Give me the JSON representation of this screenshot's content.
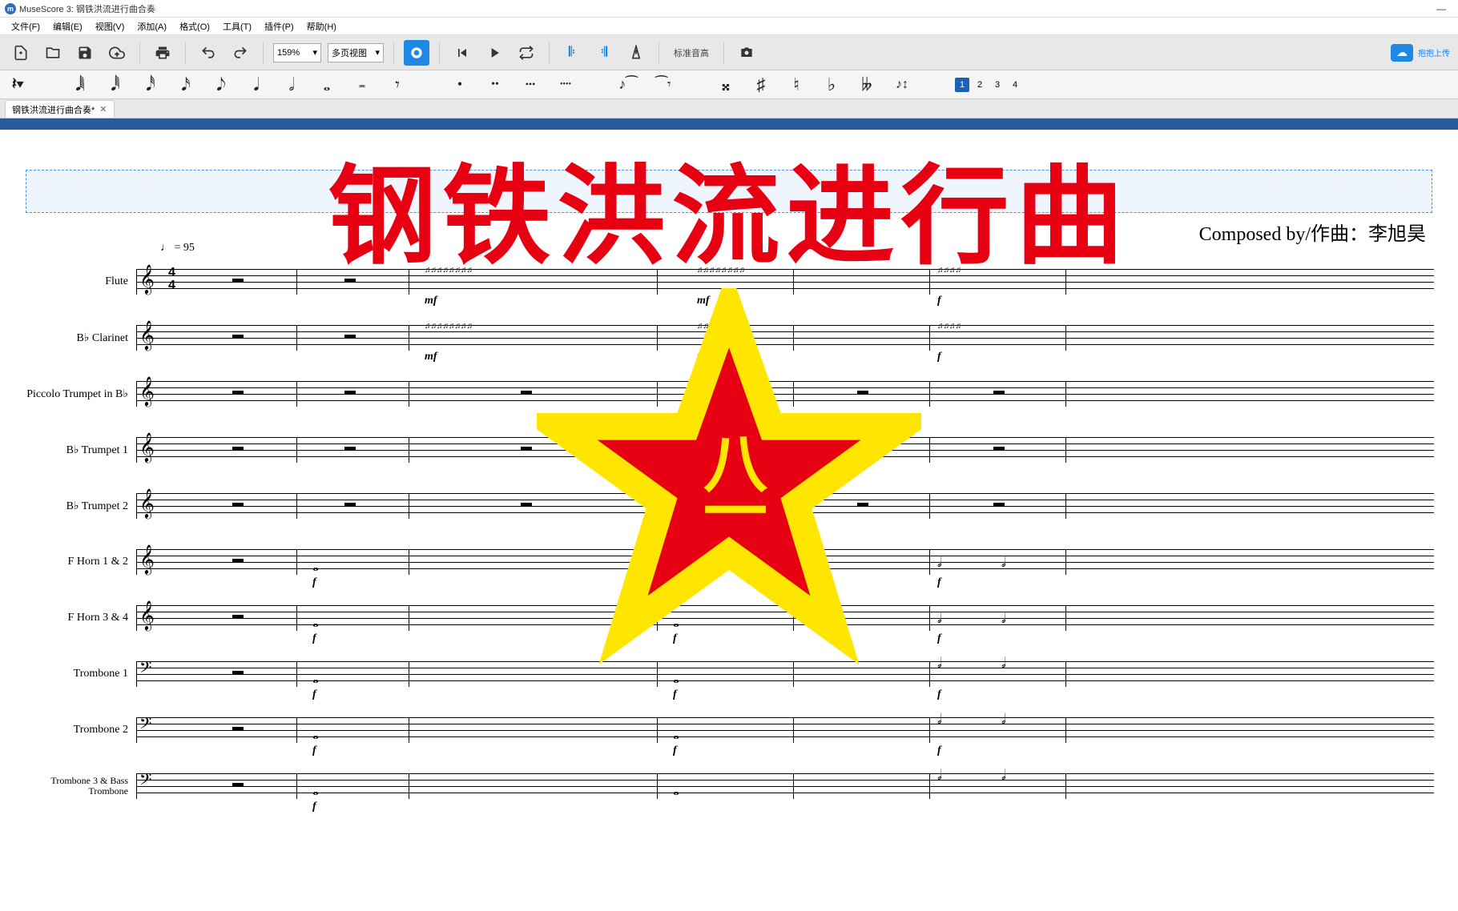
{
  "titlebar": {
    "app_name": "MuseScore 3: 钢铁洪流进行曲合奏"
  },
  "menubar": {
    "items": [
      "文件(F)",
      "编辑(E)",
      "视图(V)",
      "添加(A)",
      "格式(O)",
      "工具(T)",
      "插件(P)",
      "帮助(H)"
    ]
  },
  "toolbar": {
    "zoom": "159%",
    "view_mode": "多页视图",
    "concert_pitch": "标准音高",
    "upload_label": "抱抱上传"
  },
  "voices": [
    "1",
    "2",
    "3",
    "4"
  ],
  "tab": {
    "name": "钢铁洪流进行曲合奏*"
  },
  "score": {
    "composer_label": "Composed by/作曲：李旭昊",
    "tempo": "♩ = 95",
    "time_signature_top": "4",
    "time_signature_bottom": "4",
    "instruments": [
      "Flute",
      "B♭ Clarinet",
      "Piccolo Trumpet in B♭",
      "B♭ Trumpet 1",
      "B♭ Trumpet 2",
      "F Horn 1 & 2",
      "F Horn 3 & 4",
      "Trombone 1",
      "Trombone 2",
      "Trombone 3 & Bass Trombone"
    ],
    "dynamics": {
      "mf": "mf",
      "f": "f"
    }
  },
  "overlay": {
    "title": "钢铁洪流进行曲",
    "star_text": "八一"
  }
}
